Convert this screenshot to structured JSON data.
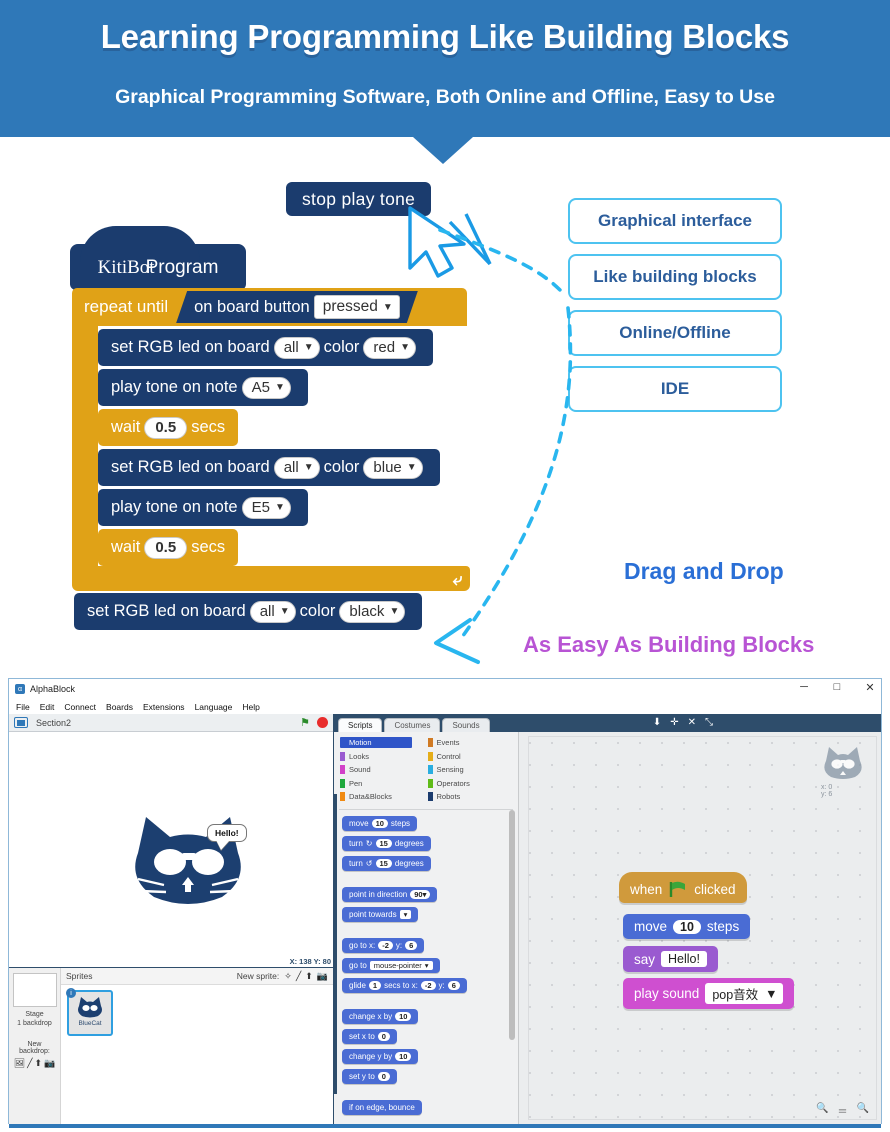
{
  "banner": {
    "title": "Learning Programming Like Building Blocks",
    "subtitle": "Graphical Programming Software, Both Online and Offline, Easy to Use",
    "bg_color": "#2f78b8"
  },
  "blocks_demo": {
    "standalone_block": "stop play tone",
    "hat": {
      "name_serif": "KitiBot",
      "name_sans": "Program"
    },
    "repeat": {
      "label": "repeat until",
      "condition_text": "on board button",
      "condition_value": "pressed"
    },
    "statements": [
      {
        "label_a": "set",
        "label_b": "RGB",
        "label_c": "led on board",
        "target": "all",
        "label_d": "color",
        "value": "red",
        "type": "navy"
      },
      {
        "label": "play tone on note",
        "value": "A5",
        "type": "navy"
      },
      {
        "label_a": "wait",
        "value": "0.5",
        "label_b": "secs",
        "type": "gold"
      },
      {
        "label_a": "set",
        "label_b": "RGB",
        "label_c": "led on board",
        "target": "all",
        "label_d": "color",
        "value": "blue",
        "type": "navy"
      },
      {
        "label": "play tone on note",
        "value": "E5",
        "type": "navy"
      },
      {
        "label_a": "wait",
        "value": "0.5",
        "label_b": "secs",
        "type": "gold"
      }
    ],
    "final_statement": {
      "label_a": "set",
      "label_b": "RGB",
      "label_c": "led on board",
      "target": "all",
      "label_d": "color",
      "value": "black"
    },
    "colors": {
      "navy": "#1b3c6e",
      "gold": "#e0a217"
    }
  },
  "features": [
    {
      "label": "Graphical interface"
    },
    {
      "label": "Like building blocks"
    },
    {
      "label": "Online/Offline"
    },
    {
      "label": "IDE"
    }
  ],
  "annotations": {
    "drag_and_drop": "Drag and Drop",
    "as_easy": "As Easy As Building Blocks",
    "drag_color": "#2a6fd6",
    "easy_color": "#b854d4",
    "arrow_color": "#29b6ef"
  },
  "app": {
    "title": "AlphaBlock",
    "window_controls": {
      "minimize": "─",
      "maximize": "□",
      "close": "✕"
    },
    "menus": [
      "File",
      "Edit",
      "Connect",
      "Boards",
      "Extensions",
      "Language",
      "Help"
    ],
    "stage": {
      "project_name": "Section2",
      "speech_bubble": "Hello!",
      "coords": "X: 138  Y: 80"
    },
    "sprites_pane": {
      "stage_label": "Stage",
      "backdrop_count": "1 backdrop",
      "new_backdrop_label": "New backdrop:",
      "sprites_label": "Sprites",
      "new_sprite_label": "New sprite:",
      "sprite": {
        "name": "BlueCat",
        "badge": "i"
      }
    },
    "editor": {
      "tabs": [
        {
          "label": "Scripts",
          "active": true
        },
        {
          "label": "Costumes",
          "active": false
        },
        {
          "label": "Sounds",
          "active": false
        }
      ],
      "toolbar_icons": [
        "download-icon",
        "add-icon",
        "shrink-icon",
        "expand-icon"
      ],
      "categories_left": [
        {
          "label": "Motion",
          "color": "#2f55c8",
          "selected": true
        },
        {
          "label": "Looks",
          "color": "#9a5ad0",
          "selected": false
        },
        {
          "label": "Sound",
          "color": "#d241c8",
          "selected": false
        },
        {
          "label": "Pen",
          "color": "#1fa83c",
          "selected": false
        },
        {
          "label": "Data&Blocks",
          "color": "#f08a12",
          "selected": false
        }
      ],
      "categories_right": [
        {
          "label": "Events",
          "color": "#d07a23",
          "selected": false
        },
        {
          "label": "Control",
          "color": "#e5ae1a",
          "selected": false
        },
        {
          "label": "Sensing",
          "color": "#2aaee0",
          "selected": false
        },
        {
          "label": "Operators",
          "color": "#5fbb18",
          "selected": false
        },
        {
          "label": "Robots",
          "color": "#1b3c6e",
          "selected": false
        }
      ],
      "palette_blocks": [
        {
          "kind": "oval",
          "pre": "move",
          "val": "10",
          "post": "steps"
        },
        {
          "kind": "turn_cw",
          "pre": "turn",
          "val": "15",
          "post": "degrees"
        },
        {
          "kind": "turn_ccw",
          "pre": "turn",
          "val": "15",
          "post": "degrees"
        },
        {
          "kind": "gap"
        },
        {
          "kind": "oval",
          "pre": "point in direction",
          "val": "90▾",
          "post": ""
        },
        {
          "kind": "dropdown",
          "pre": "point towards",
          "val": "",
          "post": ""
        },
        {
          "kind": "gap"
        },
        {
          "kind": "xy",
          "pre": "go to x:",
          "val": "-2",
          "mid": "y:",
          "val2": "6",
          "post": ""
        },
        {
          "kind": "dropdown",
          "pre": "go to",
          "val": "mouse-pointer",
          "post": ""
        },
        {
          "kind": "glide",
          "pre": "glide",
          "val": "1",
          "mid": "secs to x:",
          "val2": "-2",
          "mid2": "y:",
          "val3": "6"
        },
        {
          "kind": "gap"
        },
        {
          "kind": "oval",
          "pre": "change x by",
          "val": "10",
          "post": ""
        },
        {
          "kind": "oval",
          "pre": "set x to",
          "val": "0",
          "post": ""
        },
        {
          "kind": "oval",
          "pre": "change y by",
          "val": "10",
          "post": ""
        },
        {
          "kind": "oval",
          "pre": "set y to",
          "val": "0",
          "post": ""
        },
        {
          "kind": "gap"
        },
        {
          "kind": "plain",
          "pre": "if on edge, bounce",
          "val": "",
          "post": ""
        }
      ],
      "script": [
        {
          "type": "hat",
          "pre": "when",
          "icon": "green-flag-icon",
          "post": "clicked"
        },
        {
          "type": "motion",
          "pre": "move",
          "value": "10",
          "post": "steps"
        },
        {
          "type": "looks",
          "pre": "say",
          "value": "Hello!",
          "post": ""
        },
        {
          "type": "sound",
          "pre": "play sound",
          "value": "pop音效",
          "post": ""
        }
      ],
      "watermark_coords": {
        "x": "x: 0",
        "y": "y: 6"
      },
      "zoom_controls": [
        "zoom-out",
        "zoom-reset",
        "zoom-in"
      ]
    }
  }
}
